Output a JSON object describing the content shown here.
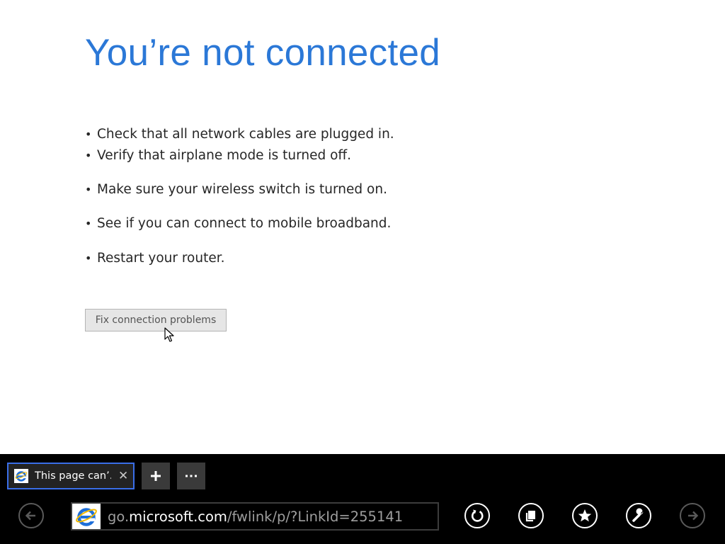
{
  "error_page": {
    "title": "You’re not connected",
    "tips": [
      "Check that all network cables are plugged in.",
      "Verify that airplane mode is turned off.",
      "Make sure your wireless switch is turned on.",
      "See if you can connect to mobile broadband.",
      "Restart your router."
    ],
    "bullet": "•",
    "fix_button_label": "Fix connection problems"
  },
  "app_bar": {
    "tab": {
      "title": "This page can’...",
      "close_glyph": "✕",
      "icon": "ie-icon"
    },
    "new_tab_glyph": "+",
    "more_glyph": "⋯",
    "address": {
      "prefix": "go.",
      "domain": "microsoft.com",
      "path": "/fwlink/p/?LinkId=255141",
      "icon": "ie-icon"
    },
    "buttons": {
      "back": "back-arrow-icon",
      "refresh": "refresh-icon",
      "tabs": "page-tools-icon",
      "favorites": "star-icon",
      "tools": "wrench-icon",
      "forward": "forward-arrow-icon"
    }
  },
  "colors": {
    "title": "#2b78d7",
    "accent_border": "#3a6ee8",
    "ie_blue": "#1e6fd9",
    "app_bar": "#000000"
  }
}
